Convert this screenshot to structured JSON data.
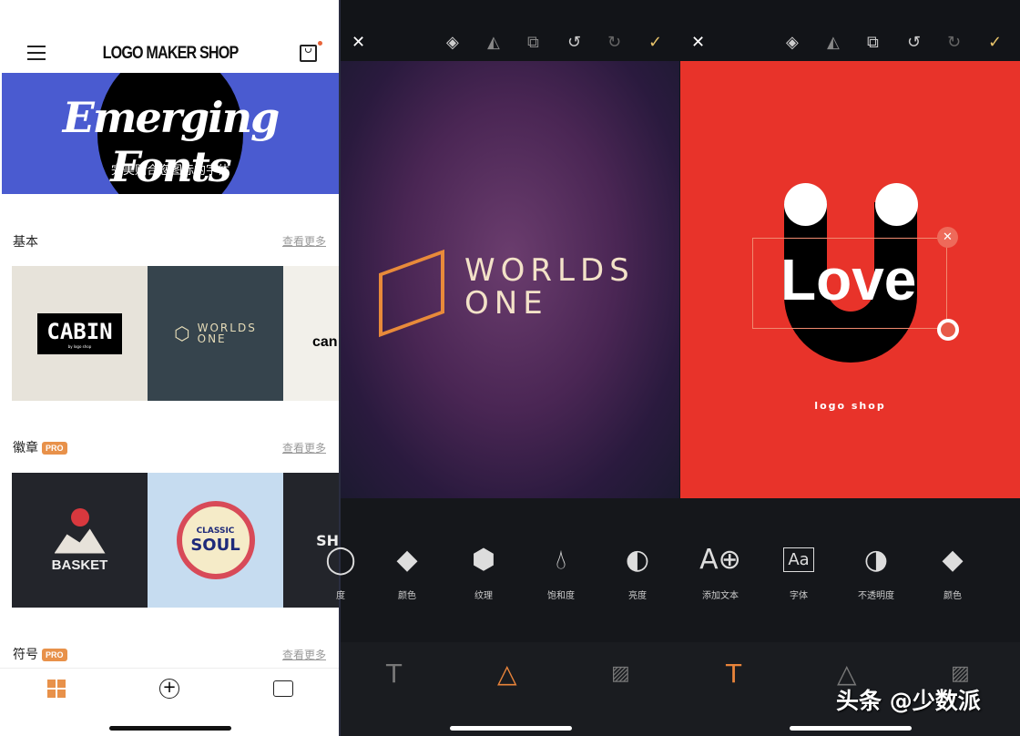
{
  "shop": {
    "title": "LOGO MAKER SHOP",
    "banner_title": "Emerging Fonts",
    "banner_subtitle": "完美贴合您图标的字体",
    "sections": [
      {
        "title": "基本",
        "more": "查看更多",
        "pro": false
      },
      {
        "title": "徽章",
        "more": "查看更多",
        "pro": true,
        "badge": "PRO"
      },
      {
        "title": "符号",
        "more": "查看更多",
        "pro": true,
        "badge": "PRO"
      }
    ],
    "cards_basic": [
      {
        "text": "CABIN",
        "sub": "by logo shop"
      },
      {
        "text": "WORLDS",
        "text2": "ONE"
      },
      {
        "text": "can"
      }
    ],
    "cards_badge": [
      {
        "text": "BASKET"
      },
      {
        "text": "CLASSIC",
        "text2": "SOUL"
      },
      {
        "text": "SH"
      }
    ],
    "accent": "#e8914a",
    "banner_color": "#4a5bd0"
  },
  "editor1": {
    "logo_line1": "WORLDS",
    "logo_line2": "ONE",
    "tools": [
      {
        "label": "度",
        "icon": "circle-icon"
      },
      {
        "label": "颜色",
        "icon": "paint-bucket-icon"
      },
      {
        "label": "纹理",
        "icon": "texture-hexagon-icon"
      },
      {
        "label": "饱和度",
        "icon": "drop-icon"
      },
      {
        "label": "亮度",
        "icon": "brightness-icon"
      }
    ]
  },
  "editor2": {
    "text": "Love",
    "brand": "logo shop",
    "canvas_color": "#e8332a",
    "tools": [
      {
        "label": "添加文本",
        "icon": "add-text-icon"
      },
      {
        "label": "字体",
        "icon": "font-icon"
      },
      {
        "label": "不透明度",
        "icon": "opacity-icon"
      },
      {
        "label": "颜色",
        "icon": "paint-bucket-icon"
      }
    ]
  },
  "watermark": "头条 @少数派"
}
